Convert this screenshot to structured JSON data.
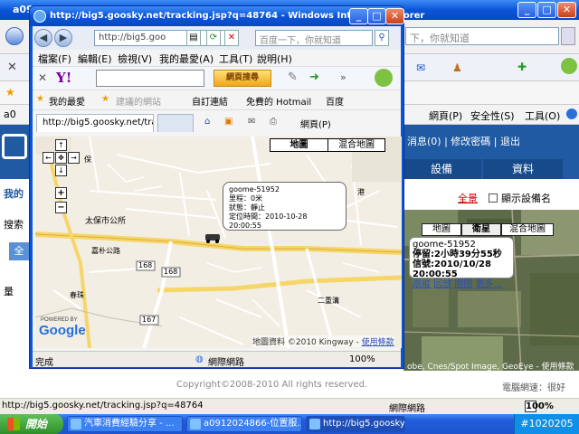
{
  "background_window": {
    "title": "a09",
    "search_placeholder": "下，你就知道",
    "tab_label": "a0",
    "toolbar_items": [
      "網頁(P)",
      "安全性(S)",
      "工具(O)"
    ],
    "header_links": "消息(0) | 修改密碼 | 退出",
    "nav_tabs": [
      "設備",
      "資料"
    ],
    "left_labels": [
      "我的",
      "搜索",
      "全",
      "量"
    ],
    "show_all": "全景",
    "show_device_name": "顯示設備名",
    "sat_map_types": [
      "地圖",
      "衛星",
      "混合地圖"
    ],
    "sat_info": {
      "name": "goome-51952",
      "stay": "停留:2小時39分55秒",
      "signal": "信號:2010/10/28 20:00:55",
      "links": [
        "跟蹤",
        "回放",
        "關閉",
        "更多..."
      ]
    },
    "sat_copyright": "obe, Cnes/Spot Image, GeoEye - 使用條款",
    "copyright": "Copyright©2008-2010 All rights reserved.",
    "network_speed": "電腦網速：很好",
    "status_url": "http://big5.goosky.net/tracking.jsp?q=48764",
    "status_zone": "網際網路",
    "status_zoom": "100%"
  },
  "popup": {
    "title": "http://big5.goosky.net/tracking.jsp?q=48764 - Windows Internet Explorer",
    "address": "http://big5.goo",
    "search_placeholder": "百度一下，你就知道",
    "menu": [
      "檔案(F)",
      "編輯(E)",
      "檢視(V)",
      "我的最愛(A)",
      "工具(T)",
      "說明(H)"
    ],
    "yahoo_logo": "Y!",
    "yahoo_search_button": "網頁搜尋",
    "favorites": [
      "我的最愛",
      "建議的網站",
      "自訂連結",
      "免費的 Hotmail",
      "百度"
    ],
    "tab_title": "http://big5.goosky.net/track...",
    "tab_tools": [
      "網頁(P)"
    ],
    "map_types": [
      "地圖",
      "混合地圖"
    ],
    "map_labels": [
      "太保市公所",
      "嘉朴公路",
      "春珠",
      "二重溝",
      "保",
      "港"
    ],
    "road_numbers": [
      "168",
      "168",
      "167"
    ],
    "infobox": {
      "name": "goome-51952",
      "mileage": "里程：0米",
      "status": "狀態：靜止",
      "time": "定位時間：2010-10-28 20:00:55"
    },
    "powered_by": "POWERED BY",
    "google_logo": "Google",
    "map_copyright": "地圖資料 ©2010 Kingway - ",
    "map_terms": "使用條款",
    "status_done": "完成",
    "status_zone": "網際網路",
    "status_zoom": "100%"
  },
  "taskbar": {
    "start": "開始",
    "tasks": [
      "汽車消費經驗分享 - ...",
      "a0912024866-位置服...",
      "http://big5.goosky.net/..."
    ],
    "watermark": "#1020205"
  }
}
